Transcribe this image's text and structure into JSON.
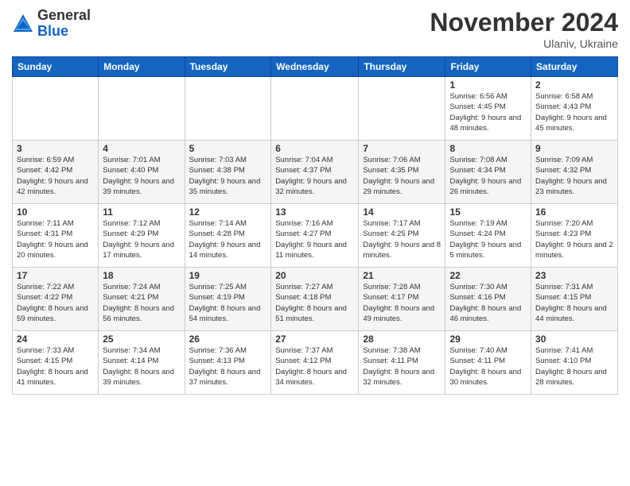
{
  "header": {
    "logo_general": "General",
    "logo_blue": "Blue",
    "month_title": "November 2024",
    "location": "Ulaniv, Ukraine"
  },
  "days_of_week": [
    "Sunday",
    "Monday",
    "Tuesday",
    "Wednesday",
    "Thursday",
    "Friday",
    "Saturday"
  ],
  "weeks": [
    [
      {
        "day": "",
        "info": ""
      },
      {
        "day": "",
        "info": ""
      },
      {
        "day": "",
        "info": ""
      },
      {
        "day": "",
        "info": ""
      },
      {
        "day": "",
        "info": ""
      },
      {
        "day": "1",
        "info": "Sunrise: 6:56 AM\nSunset: 4:45 PM\nDaylight: 9 hours and 48 minutes."
      },
      {
        "day": "2",
        "info": "Sunrise: 6:58 AM\nSunset: 4:43 PM\nDaylight: 9 hours and 45 minutes."
      }
    ],
    [
      {
        "day": "3",
        "info": "Sunrise: 6:59 AM\nSunset: 4:42 PM\nDaylight: 9 hours and 42 minutes."
      },
      {
        "day": "4",
        "info": "Sunrise: 7:01 AM\nSunset: 4:40 PM\nDaylight: 9 hours and 39 minutes."
      },
      {
        "day": "5",
        "info": "Sunrise: 7:03 AM\nSunset: 4:38 PM\nDaylight: 9 hours and 35 minutes."
      },
      {
        "day": "6",
        "info": "Sunrise: 7:04 AM\nSunset: 4:37 PM\nDaylight: 9 hours and 32 minutes."
      },
      {
        "day": "7",
        "info": "Sunrise: 7:06 AM\nSunset: 4:35 PM\nDaylight: 9 hours and 29 minutes."
      },
      {
        "day": "8",
        "info": "Sunrise: 7:08 AM\nSunset: 4:34 PM\nDaylight: 9 hours and 26 minutes."
      },
      {
        "day": "9",
        "info": "Sunrise: 7:09 AM\nSunset: 4:32 PM\nDaylight: 9 hours and 23 minutes."
      }
    ],
    [
      {
        "day": "10",
        "info": "Sunrise: 7:11 AM\nSunset: 4:31 PM\nDaylight: 9 hours and 20 minutes."
      },
      {
        "day": "11",
        "info": "Sunrise: 7:12 AM\nSunset: 4:29 PM\nDaylight: 9 hours and 17 minutes."
      },
      {
        "day": "12",
        "info": "Sunrise: 7:14 AM\nSunset: 4:28 PM\nDaylight: 9 hours and 14 minutes."
      },
      {
        "day": "13",
        "info": "Sunrise: 7:16 AM\nSunset: 4:27 PM\nDaylight: 9 hours and 11 minutes."
      },
      {
        "day": "14",
        "info": "Sunrise: 7:17 AM\nSunset: 4:25 PM\nDaylight: 9 hours and 8 minutes."
      },
      {
        "day": "15",
        "info": "Sunrise: 7:19 AM\nSunset: 4:24 PM\nDaylight: 9 hours and 5 minutes."
      },
      {
        "day": "16",
        "info": "Sunrise: 7:20 AM\nSunset: 4:23 PM\nDaylight: 9 hours and 2 minutes."
      }
    ],
    [
      {
        "day": "17",
        "info": "Sunrise: 7:22 AM\nSunset: 4:22 PM\nDaylight: 8 hours and 59 minutes."
      },
      {
        "day": "18",
        "info": "Sunrise: 7:24 AM\nSunset: 4:21 PM\nDaylight: 8 hours and 56 minutes."
      },
      {
        "day": "19",
        "info": "Sunrise: 7:25 AM\nSunset: 4:19 PM\nDaylight: 8 hours and 54 minutes."
      },
      {
        "day": "20",
        "info": "Sunrise: 7:27 AM\nSunset: 4:18 PM\nDaylight: 8 hours and 51 minutes."
      },
      {
        "day": "21",
        "info": "Sunrise: 7:28 AM\nSunset: 4:17 PM\nDaylight: 8 hours and 49 minutes."
      },
      {
        "day": "22",
        "info": "Sunrise: 7:30 AM\nSunset: 4:16 PM\nDaylight: 8 hours and 46 minutes."
      },
      {
        "day": "23",
        "info": "Sunrise: 7:31 AM\nSunset: 4:15 PM\nDaylight: 8 hours and 44 minutes."
      }
    ],
    [
      {
        "day": "24",
        "info": "Sunrise: 7:33 AM\nSunset: 4:15 PM\nDaylight: 8 hours and 41 minutes."
      },
      {
        "day": "25",
        "info": "Sunrise: 7:34 AM\nSunset: 4:14 PM\nDaylight: 8 hours and 39 minutes."
      },
      {
        "day": "26",
        "info": "Sunrise: 7:36 AM\nSunset: 4:13 PM\nDaylight: 8 hours and 37 minutes."
      },
      {
        "day": "27",
        "info": "Sunrise: 7:37 AM\nSunset: 4:12 PM\nDaylight: 8 hours and 34 minutes."
      },
      {
        "day": "28",
        "info": "Sunrise: 7:38 AM\nSunset: 4:11 PM\nDaylight: 8 hours and 32 minutes."
      },
      {
        "day": "29",
        "info": "Sunrise: 7:40 AM\nSunset: 4:11 PM\nDaylight: 8 hours and 30 minutes."
      },
      {
        "day": "30",
        "info": "Sunrise: 7:41 AM\nSunset: 4:10 PM\nDaylight: 8 hours and 28 minutes."
      }
    ]
  ]
}
